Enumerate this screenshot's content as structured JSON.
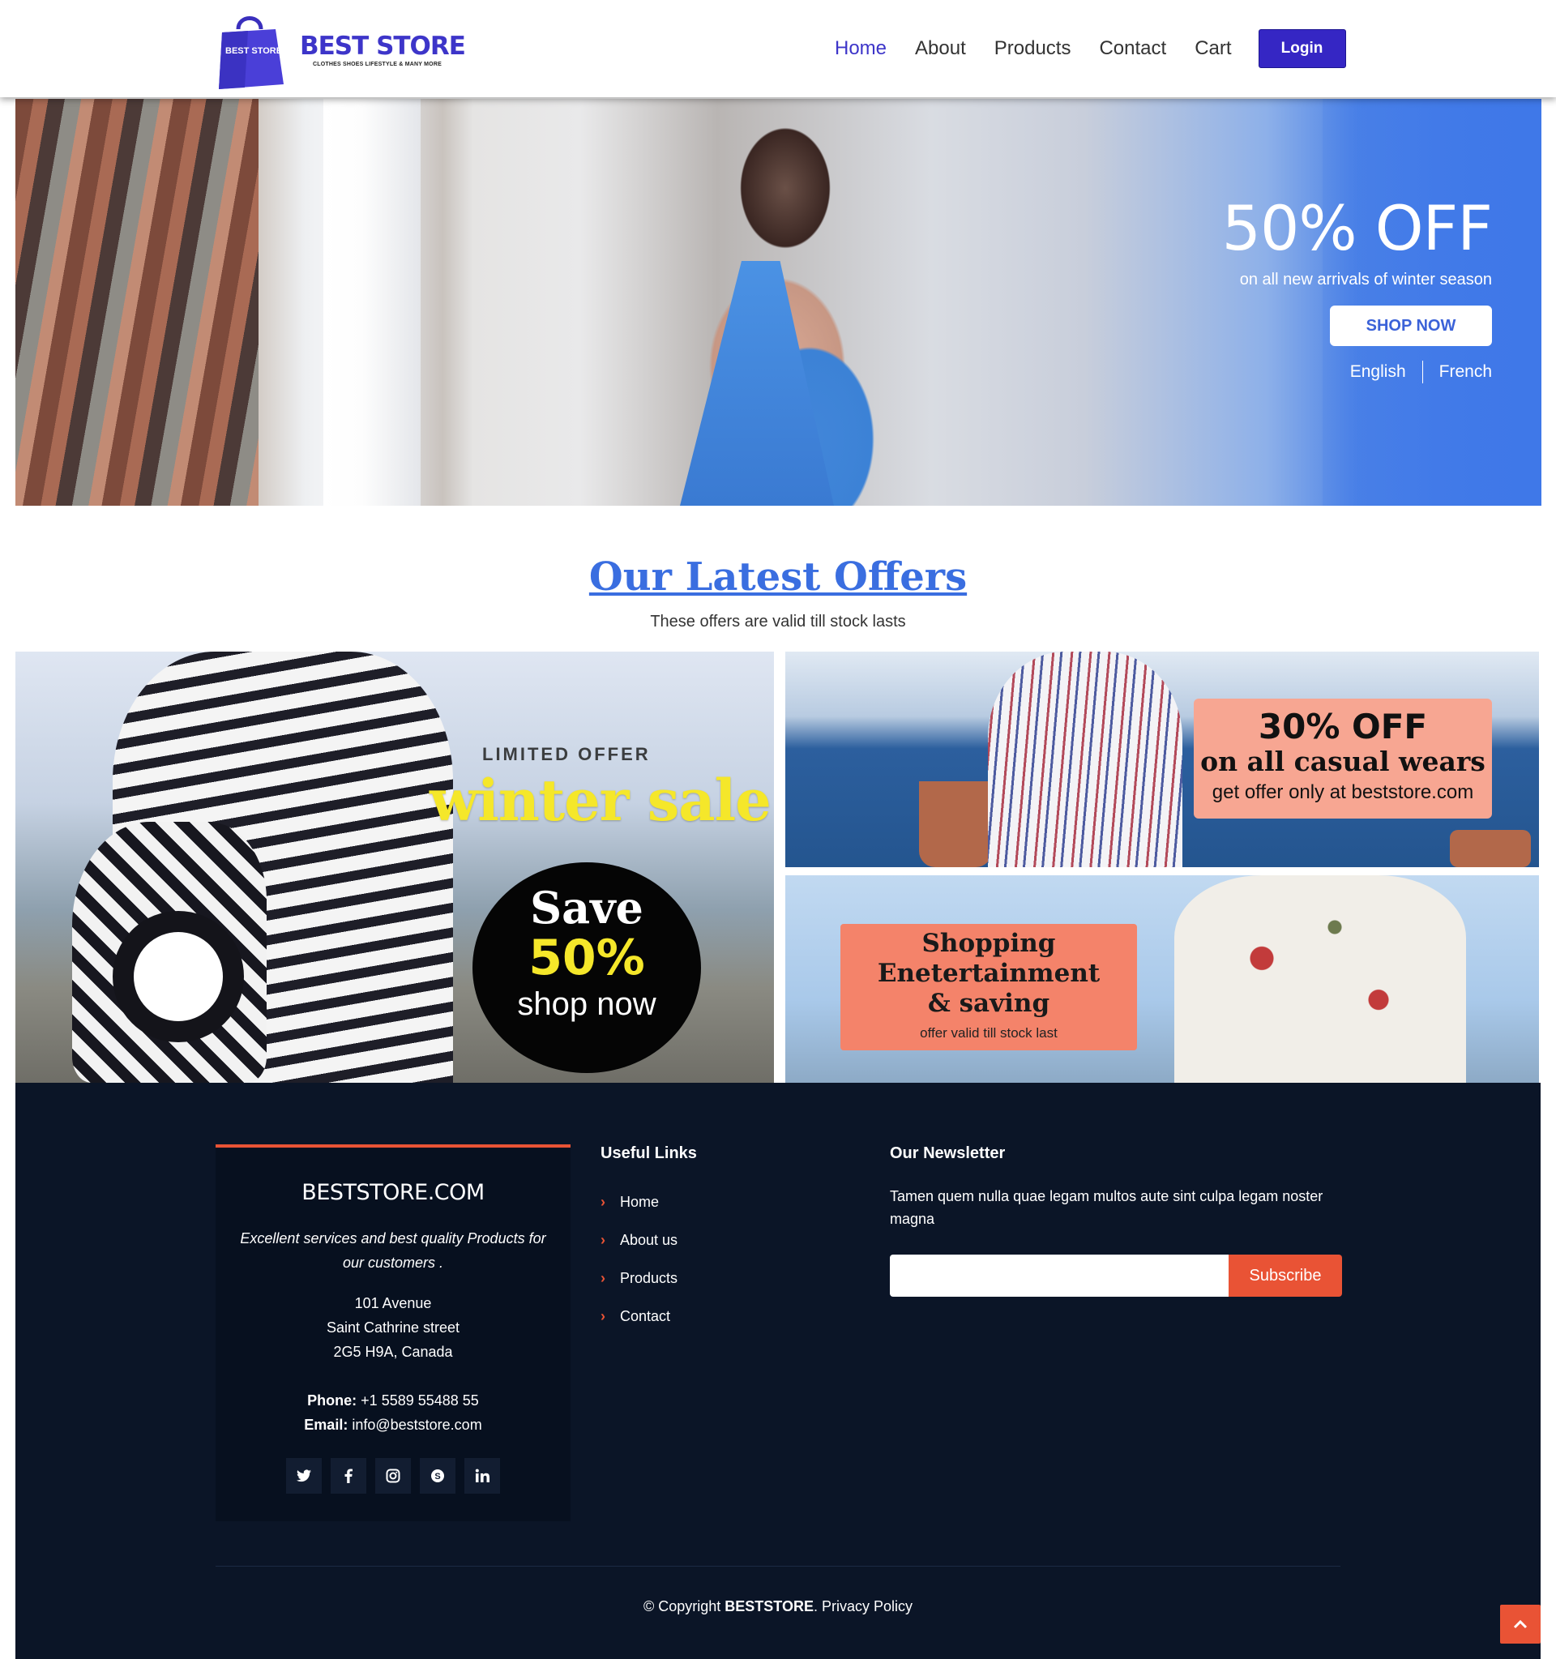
{
  "header": {
    "brand_name": "BEST STORE",
    "brand_tagline": "CLOTHES SHOES LIFESTYLE & MANY MORE",
    "logo_bag_text": "BEST STORE",
    "nav": [
      {
        "label": "Home",
        "active": true
      },
      {
        "label": "About"
      },
      {
        "label": "Products"
      },
      {
        "label": "Contact"
      },
      {
        "label": "Cart"
      }
    ],
    "login_label": "Login",
    "accent": "#3526c4"
  },
  "hero": {
    "title": "50% OFF",
    "subtitle": "on all new arrivals of winter season",
    "cta": "SHOP NOW",
    "languages": [
      "English",
      "French"
    ]
  },
  "offers": {
    "title": "Our Latest Offers",
    "subtitle": "These offers are valid till stock lasts",
    "big": {
      "limited": "LIMITED OFFER",
      "headline": "winter sale",
      "save": "Save",
      "percent": "50%",
      "cta": "shop now"
    },
    "top": {
      "line1": "30% OFF",
      "line2": "on all casual wears",
      "line3": "get offer only at beststore.com"
    },
    "bottom": {
      "line1": "Shopping",
      "line2": "Enetertainment",
      "line3": "& saving",
      "line4": "offer valid till stock last"
    }
  },
  "footer": {
    "brand": "BESTSTORE.COM",
    "description": "Excellent services and best quality Products for our customers .",
    "address": [
      "101 Avenue",
      "Saint Cathrine street",
      "2G5 H9A, Canada"
    ],
    "phone_label": "Phone:",
    "phone": "+1 5589 55488 55",
    "email_label": "Email:",
    "email": "info@beststore.com",
    "socials": [
      {
        "name": "twitter-icon",
        "glyph": "🐦"
      },
      {
        "name": "facebook-icon",
        "glyph": "f"
      },
      {
        "name": "instagram-icon",
        "glyph": "◎"
      },
      {
        "name": "skype-icon",
        "glyph": "S"
      },
      {
        "name": "linkedin-icon",
        "glyph": "in"
      }
    ],
    "links_title": "Useful Links",
    "links": [
      "Home",
      "About us",
      "Products",
      "Contact"
    ],
    "newsletter_title": "Our Newsletter",
    "newsletter_text": "Tamen quem nulla quae legam multos aute sint culpa legam noster magna",
    "newsletter_placeholder": "",
    "subscribe_label": "Subscribe",
    "copyright_prefix": "© Copyright ",
    "copyright_brand": "BESTSTORE",
    "copyright_suffix": ". Privacy Policy",
    "accent": "#e95335"
  }
}
